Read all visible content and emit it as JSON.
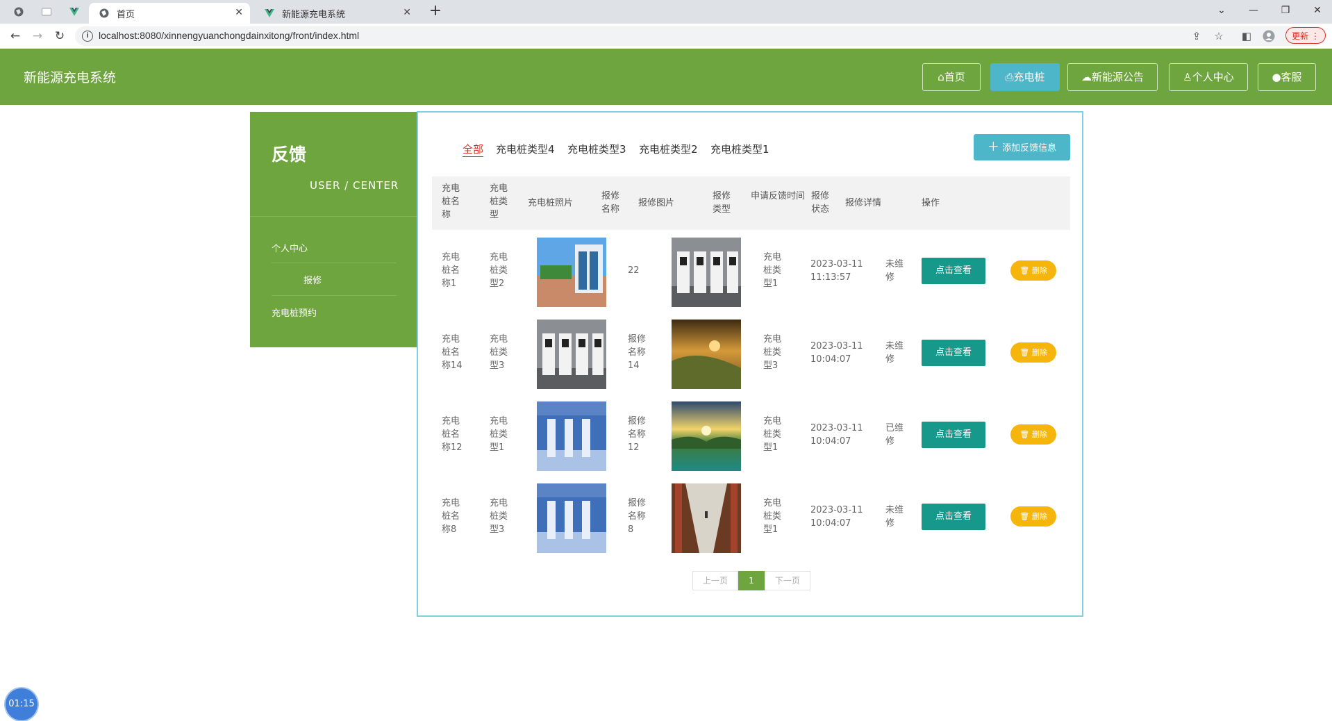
{
  "browser": {
    "tabs": [
      {
        "title": "首页"
      },
      {
        "title": "新能源充电系统"
      }
    ],
    "url": "localhost:8080/xinnengyuanchongdainxitong/front/index.html",
    "update_label": "更新"
  },
  "site": {
    "brand": "新能源充电系统",
    "nav": [
      "首页",
      "充电桩",
      "新能源公告",
      "个人中心",
      "客服"
    ],
    "accent": "#6fa53f",
    "active_nav_color": "#4db6c8"
  },
  "sidebar": {
    "title": "反馈",
    "subtitle": "USER / CENTER",
    "items": [
      {
        "label": "个人中心"
      },
      {
        "label": "报修"
      },
      {
        "label": "充电桩预约"
      }
    ]
  },
  "filters": {
    "categories": [
      "全部",
      "充电桩类型4",
      "充电桩类型3",
      "充电桩类型2",
      "充电桩类型1"
    ],
    "add_button": "添加反馈信息"
  },
  "table": {
    "headers": [
      "充电桩名称",
      "充电桩类型",
      "充电桩照片",
      "报修名称",
      "报修图片",
      "报修类型",
      "申请反馈时间",
      "报修状态",
      "报修详情",
      "操作"
    ],
    "rows": [
      {
        "name": "充电桩名称1",
        "type": "充电桩类型2",
        "repair_name": "22",
        "repair_type": "充电桩类型1",
        "time": "2023-03-11 11:13:57",
        "status": "未维修",
        "view": "点击查看",
        "delete": "删除"
      },
      {
        "name": "充电桩名称14",
        "type": "充电桩类型3",
        "repair_name": "报修名称14",
        "repair_type": "充电桩类型3",
        "time": "2023-03-11 10:04:07",
        "status": "未维修",
        "view": "点击查看",
        "delete": "删除"
      },
      {
        "name": "充电桩名称12",
        "type": "充电桩类型1",
        "repair_name": "报修名称12",
        "repair_type": "充电桩类型1",
        "time": "2023-03-11 10:04:07",
        "status": "已维修",
        "view": "点击查看",
        "delete": "删除"
      },
      {
        "name": "充电桩名称8",
        "type": "充电桩类型3",
        "repair_name": "报修名称8",
        "repair_type": "充电桩类型1",
        "time": "2023-03-11 10:04:07",
        "status": "未维修",
        "view": "点击查看",
        "delete": "删除"
      }
    ]
  },
  "pagination": {
    "prev": "上一页",
    "current": "1",
    "next": "下一页"
  },
  "timer": "01:15"
}
